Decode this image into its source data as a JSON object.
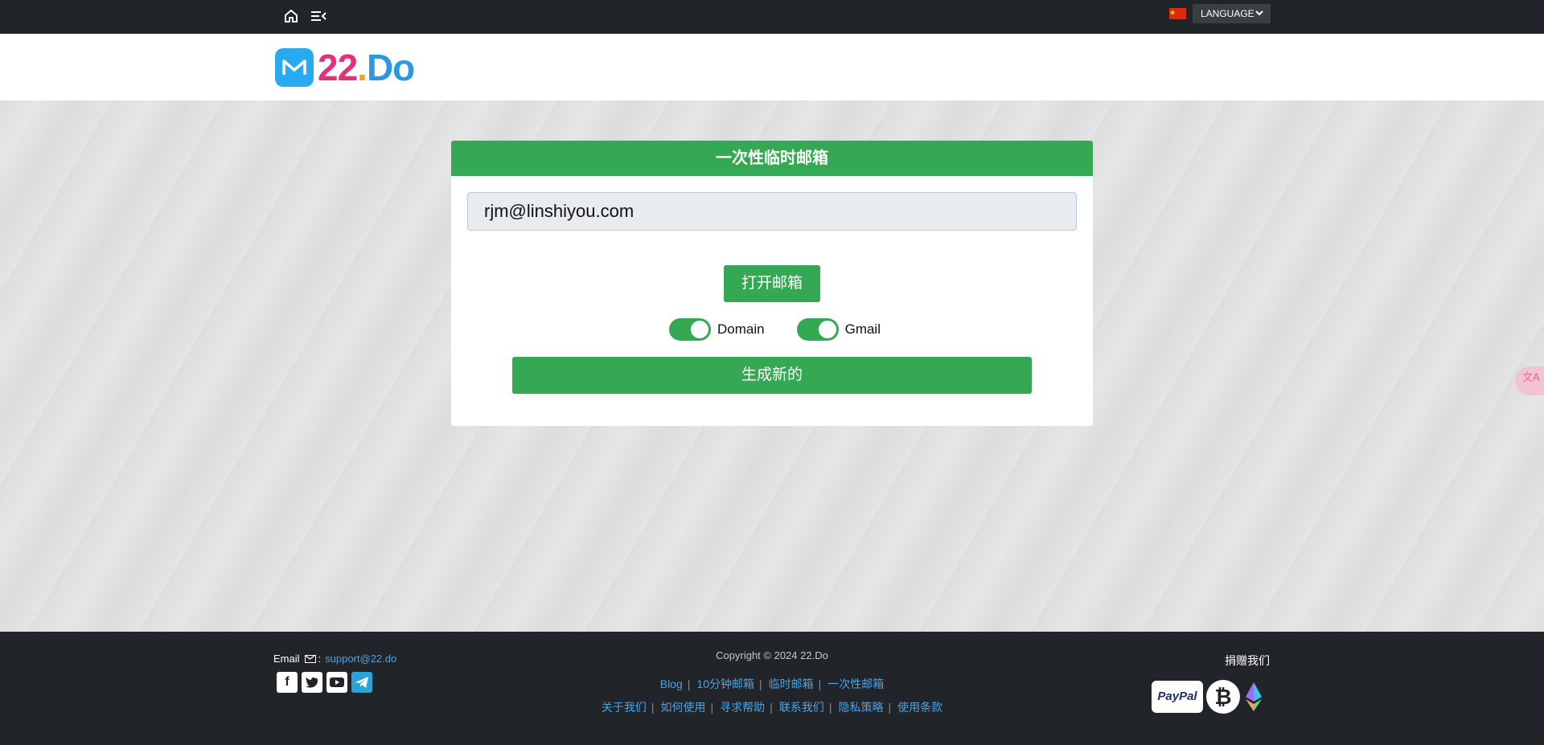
{
  "topbar": {
    "language_label": "LANGUAGE",
    "home_icon": "home-icon",
    "menu_icon": "menu-collapse-icon",
    "flag_icon": "china-flag-icon"
  },
  "header": {
    "logo_22": "22",
    "logo_dot": ".",
    "logo_do": "Do"
  },
  "card": {
    "title": "一次性临时邮箱",
    "email": "rjm@linshiyou.com",
    "open_button": "打开邮箱",
    "toggle_domain": "Domain",
    "toggle_gmail": "Gmail",
    "toggle_domain_on": true,
    "toggle_gmail_on": true,
    "generate_button": "生成新的"
  },
  "footer": {
    "email_label": "Email",
    "email_colon": ":",
    "email_value": "support@22.do",
    "copyright": "Copyright © 2024 22.Do",
    "links_row1": [
      "Blog",
      "10分钟邮箱",
      "临时邮箱",
      "一次性邮箱"
    ],
    "links_row2": [
      "关于我们",
      "如何使用",
      "寻求帮助",
      "联系我们",
      "隐私策略",
      "使用条款"
    ],
    "donate_label": "捐赠我们",
    "paypal_label": "PayPal",
    "socials": [
      "facebook-icon",
      "twitter-icon",
      "youtube-icon",
      "telegram-icon"
    ]
  },
  "colors": {
    "accent_green": "#34a853",
    "dark_bar": "#212529",
    "link_blue": "#4aa3e6"
  }
}
